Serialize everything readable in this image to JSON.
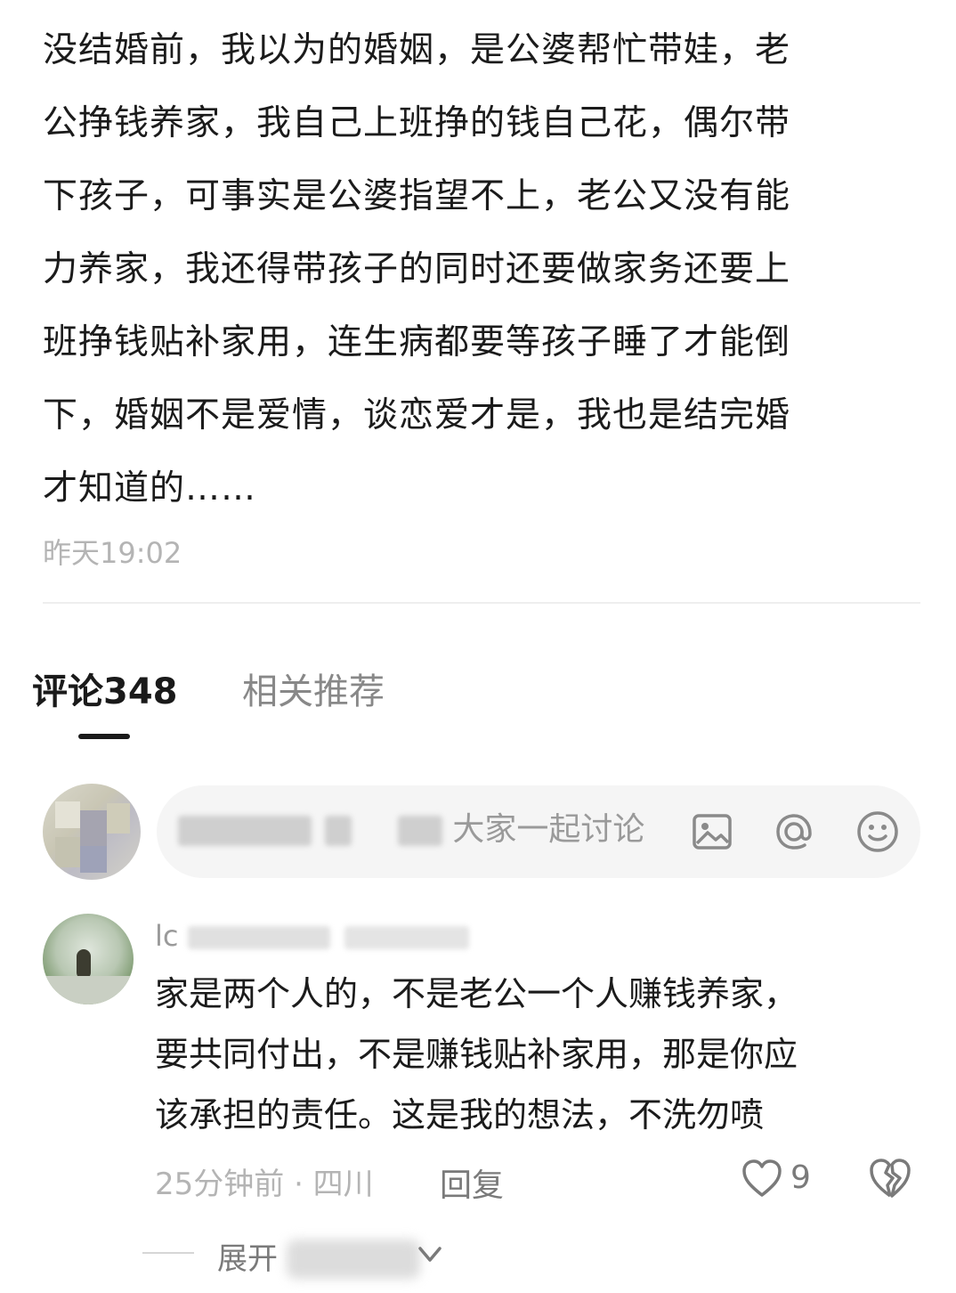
{
  "post": {
    "lines": [
      "没结婚前，我以为的婚姻，是公婆帮忙带娃，老",
      "公挣钱养家，我自己上班挣的钱自己花，偶尔带",
      "下孩子，可事实是公婆指望不上，老公又没有能",
      "力养家，我还得带孩子的同时还要做家务还要上",
      "班挣钱贴补家用，连生病都要等孩子睡了才能倒",
      "下，婚姻不是爱情，谈恋爱才是，我也是结完婚",
      "才知道的……"
    ],
    "timestamp": "昨天19:02"
  },
  "tabs": {
    "comments": "评论348",
    "related": "相关推荐"
  },
  "input": {
    "placeholder_visible": "大家一起讨论",
    "icons": [
      "image-icon",
      "at-icon",
      "emoji-icon"
    ]
  },
  "comment": {
    "username_visible": "lc",
    "lines": [
      "家是两个人的，不是老公一个人赚钱养家，",
      "要共同付出，不是赚钱贴补家用，那是你应",
      "该承担的责任。这是我的想法，不洗勿喷"
    ],
    "meta": "25分钟前 · 四川",
    "reply": "回复",
    "likes": "9",
    "expand_prefix": "展开"
  }
}
